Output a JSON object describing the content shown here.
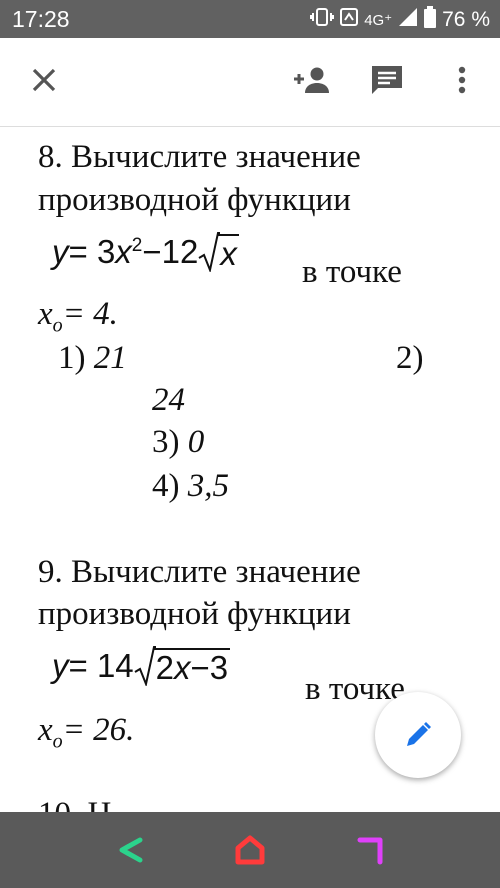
{
  "status_bar": {
    "time": "17:28",
    "network": "4G⁺",
    "battery": "76 %"
  },
  "toolbar": {
    "close_icon": "close-icon",
    "add_person_icon": "person-add-icon",
    "comment_icon": "comment-icon",
    "more_icon": "more-vert-icon"
  },
  "question8": {
    "line1": "8. Вычислите значение",
    "line2": "производной функции",
    "formula": {
      "y": "y",
      "eq": " = 3",
      "x": "x",
      "exp": "2",
      "minus": " −12",
      "radicand": "x"
    },
    "at_point": "в точке",
    "x0_var": "x",
    "x0_sub": "o",
    "x0_value": "= 4.",
    "options": [
      {
        "num": "1)",
        "value": "21"
      },
      {
        "num": "2)",
        "value": "24"
      },
      {
        "num": "3)",
        "value": "0"
      },
      {
        "num": "4)",
        "value": "3,5"
      }
    ]
  },
  "question9": {
    "line1": "9. Вычислите значение",
    "line2": "производной функции",
    "formula": {
      "y": "y",
      "eq": " = 14",
      "radicand_coef": "2",
      "x": "x",
      "radicand_rest": "−3"
    },
    "at_point": "в точке",
    "x0_var": "x",
    "x0_sub": "o",
    "x0_value": "= 26.",
    "next_partial": "10. Н"
  },
  "fab": {
    "icon": "pencil-icon",
    "color": "#1a73e8"
  },
  "nav_bar": {
    "back_color": "#2bd38c",
    "home_color": "#ff3b3b",
    "recents_color": "#e040fb"
  }
}
